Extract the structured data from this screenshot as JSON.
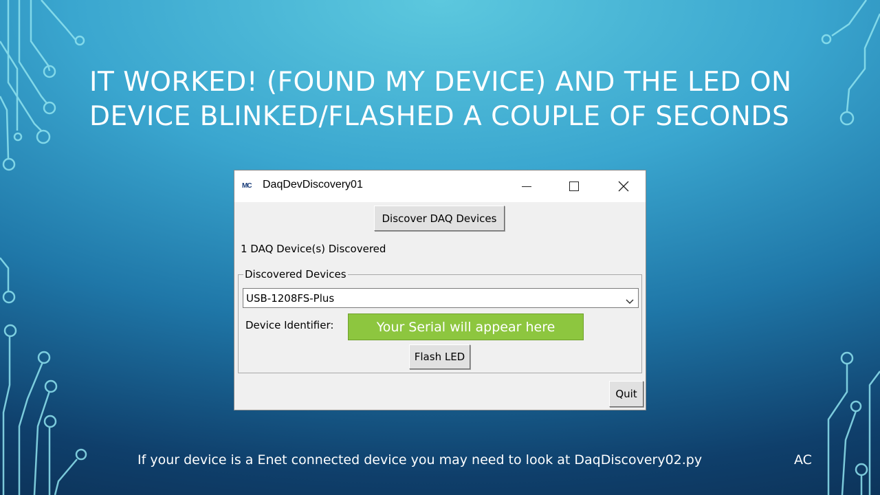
{
  "slide": {
    "title": "IT WORKED! (FOUND MY DEVICE) AND THE LED ON DEVICE BLINKED/FLASHED A COUPLE OF SECONDS",
    "footer": "If your device is a Enet connected device you may need to look at DaqDiscovery02.py",
    "author": "AC"
  },
  "window": {
    "logo": "MC",
    "title": "DaqDevDiscovery01",
    "discover_label": "Discover DAQ Devices",
    "status": "1 DAQ Device(s) Discovered",
    "group_label": "Discovered Devices",
    "selected_device": "USB-1208FS-Plus",
    "identifier_label": "Device Identifier:",
    "serial_placeholder": "Your Serial will appear here",
    "flash_label": "Flash LED",
    "quit_label": "Quit"
  },
  "colors": {
    "serial_box": "#8dc63f",
    "background_top": "#5cc8de",
    "background_bottom": "#0a2a4c"
  }
}
